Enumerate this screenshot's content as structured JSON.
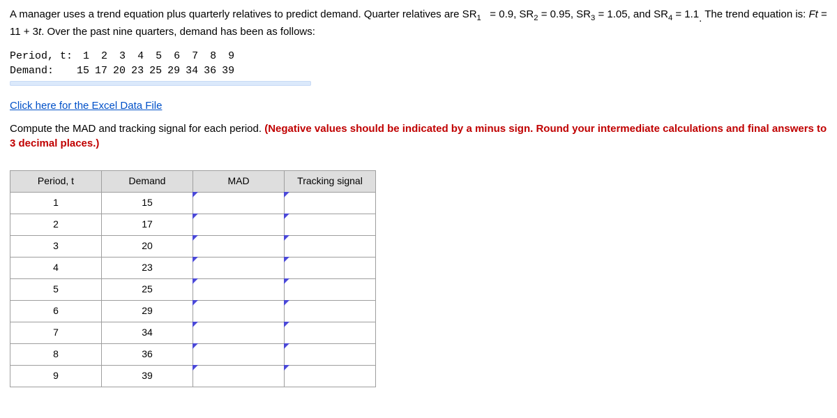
{
  "problem": {
    "intro1a": "A manager uses a trend equation plus quarterly relatives to predict demand. Quarter relatives are SR",
    "sr1_sub": "1",
    "intro1b": " = 0.9, SR",
    "sr2_sub": "2",
    "intro1c": " = 0.95, SR",
    "sr3_sub": "3",
    "intro1d": " = 1.05, and SR",
    "sr4_sub": "4",
    "intro1e": " = 1.1",
    "intro1f": " The trend equation is: ",
    "trend_eq_lhs": "Ft",
    "trend_eq_mid": " = 11 + 3",
    "trend_eq_t": "t",
    "intro1g": ". Over the past nine quarters, demand has been as follows:"
  },
  "data_table": {
    "row_labels": [
      "Period, t:",
      "Demand:"
    ],
    "periods": [
      "1",
      "2",
      "3",
      "4",
      "5",
      "6",
      "7",
      "8",
      "9"
    ],
    "demands": [
      "15",
      "17",
      "20",
      "23",
      "25",
      "29",
      "34",
      "36",
      "39"
    ]
  },
  "excel_link": "Click here for the Excel Data File",
  "instruction": {
    "part1": "Compute the MAD and tracking signal for each period. ",
    "part2": "(Negative values should be indicated by a minus sign. Round your intermediate calculations and final answers to 3 decimal places.)"
  },
  "answer_table": {
    "headers": [
      "Period, t",
      "Demand",
      "MAD",
      "Tracking signal"
    ],
    "rows": [
      {
        "period": "1",
        "demand": "15",
        "mad": "",
        "ts": ""
      },
      {
        "period": "2",
        "demand": "17",
        "mad": "",
        "ts": ""
      },
      {
        "period": "3",
        "demand": "20",
        "mad": "",
        "ts": ""
      },
      {
        "period": "4",
        "demand": "23",
        "mad": "",
        "ts": ""
      },
      {
        "period": "5",
        "demand": "25",
        "mad": "",
        "ts": ""
      },
      {
        "period": "6",
        "demand": "29",
        "mad": "",
        "ts": ""
      },
      {
        "period": "7",
        "demand": "34",
        "mad": "",
        "ts": ""
      },
      {
        "period": "8",
        "demand": "36",
        "mad": "",
        "ts": ""
      },
      {
        "period": "9",
        "demand": "39",
        "mad": "",
        "ts": ""
      }
    ]
  }
}
